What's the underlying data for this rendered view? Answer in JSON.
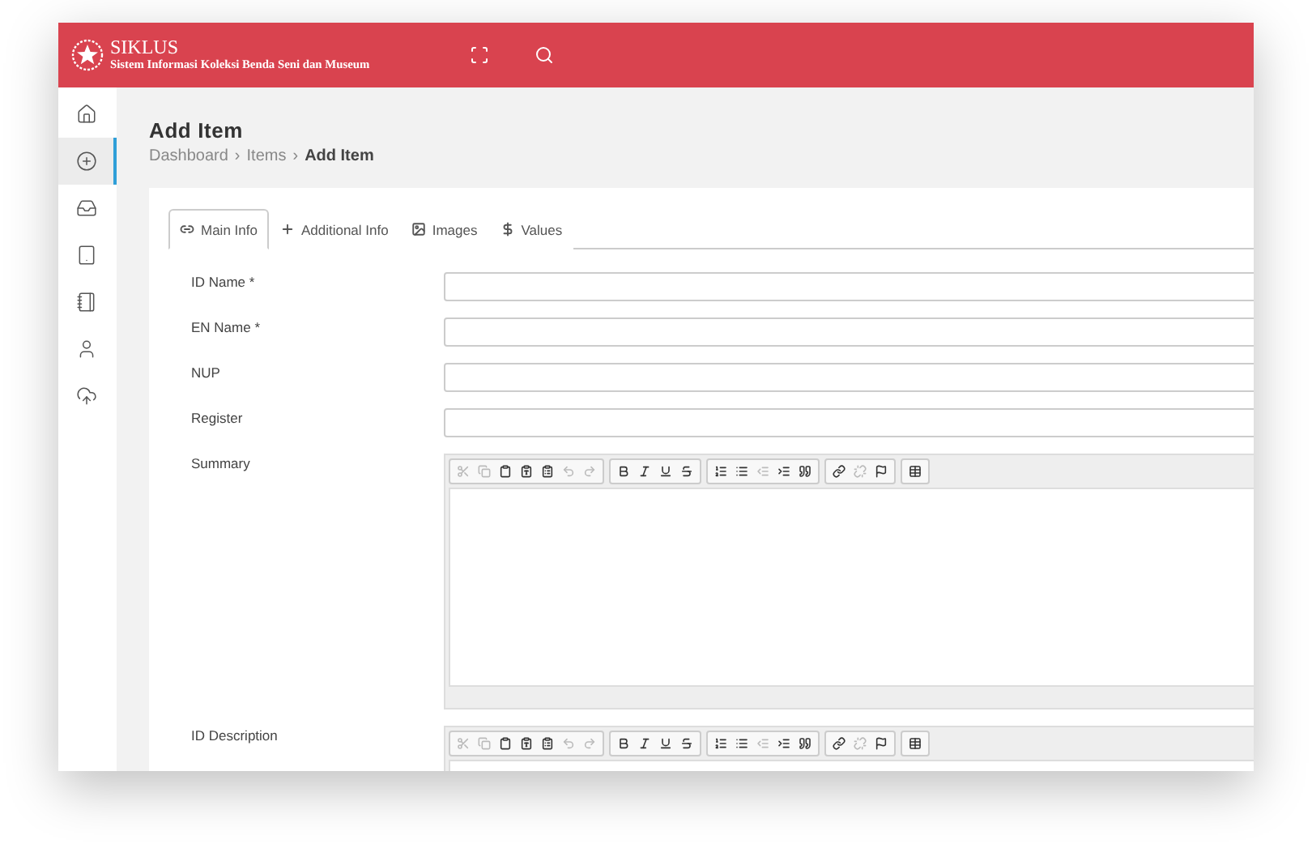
{
  "header": {
    "logo_title": "SIKLUS",
    "logo_subtitle": "Sistem Informasi Koleksi Benda Seni dan Museum"
  },
  "sidebar": {
    "items": [
      {
        "kind": "home",
        "selected": false
      },
      {
        "kind": "add",
        "selected": true
      },
      {
        "kind": "inbox",
        "selected": false
      },
      {
        "kind": "tablet",
        "selected": false
      },
      {
        "kind": "notebook",
        "selected": false
      },
      {
        "kind": "user",
        "selected": false
      },
      {
        "kind": "upload",
        "selected": false
      }
    ]
  },
  "page": {
    "title": "Add Item",
    "breadcrumb": [
      {
        "label": "Dashboard",
        "current": false
      },
      {
        "label": "Items",
        "current": false
      },
      {
        "label": "Add Item",
        "current": true
      }
    ],
    "separator": "›"
  },
  "tabs": [
    {
      "kind": "link",
      "label": "Main Info",
      "selected": true
    },
    {
      "kind": "plus",
      "label": "Additional Info",
      "selected": false
    },
    {
      "kind": "image",
      "label": "Images",
      "selected": false
    },
    {
      "kind": "dollar",
      "label": "Values",
      "selected": false
    }
  ],
  "toolbar": [
    [
      {
        "kind": "cut",
        "disabled": true
      },
      {
        "kind": "copy",
        "disabled": true
      },
      {
        "kind": "paste",
        "disabled": false
      },
      {
        "kind": "paste-text",
        "disabled": false
      },
      {
        "kind": "paste-word",
        "disabled": false
      },
      {
        "kind": "undo",
        "disabled": true
      },
      {
        "kind": "redo",
        "disabled": true
      }
    ],
    [
      {
        "kind": "bold",
        "disabled": false
      },
      {
        "kind": "italic",
        "disabled": false
      },
      {
        "kind": "underline",
        "disabled": false
      },
      {
        "kind": "strike",
        "disabled": false
      }
    ],
    [
      {
        "kind": "ordered-list",
        "disabled": false
      },
      {
        "kind": "bullet-list",
        "disabled": false
      },
      {
        "kind": "outdent",
        "disabled": true
      },
      {
        "kind": "indent",
        "disabled": false
      },
      {
        "kind": "quote",
        "disabled": false
      }
    ],
    [
      {
        "kind": "link",
        "disabled": false
      },
      {
        "kind": "unlink",
        "disabled": true
      },
      {
        "kind": "flag",
        "disabled": false
      }
    ],
    [
      {
        "kind": "table",
        "disabled": false
      }
    ]
  ],
  "fields": [
    {
      "kind": "input",
      "label": "ID Name *"
    },
    {
      "kind": "input",
      "label": "EN Name *"
    },
    {
      "kind": "input",
      "label": "NUP"
    },
    {
      "kind": "input",
      "label": "Register"
    },
    {
      "kind": "editor",
      "label": "Summary"
    },
    {
      "kind": "editor",
      "label": "ID Description"
    }
  ]
}
